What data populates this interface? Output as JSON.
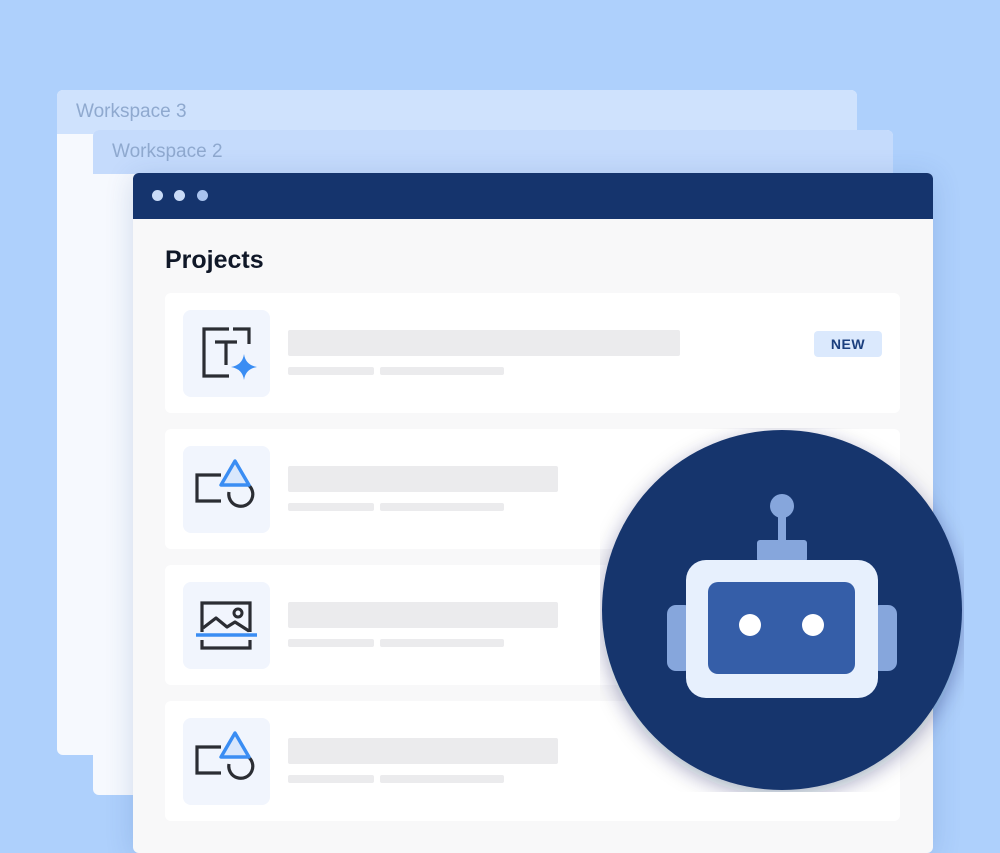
{
  "workspaces": [
    {
      "label": "Workspace 3"
    },
    {
      "label": "Workspace 2"
    }
  ],
  "window": {
    "page_title": "Projects",
    "projects": [
      {
        "icon": "text-sparkle-icon",
        "badge": "NEW"
      },
      {
        "icon": "shapes-icon"
      },
      {
        "icon": "image-icon"
      },
      {
        "icon": "shapes-icon"
      }
    ]
  },
  "illustration": {
    "icon": "robot-icon"
  },
  "colors": {
    "background": "#aed0fc",
    "titlebar": "#15346d",
    "accent_blue": "#3a8df3",
    "badge_bg": "#dbe9fd",
    "badge_text": "#1b3f7e",
    "robot_circle": "#15346d"
  }
}
